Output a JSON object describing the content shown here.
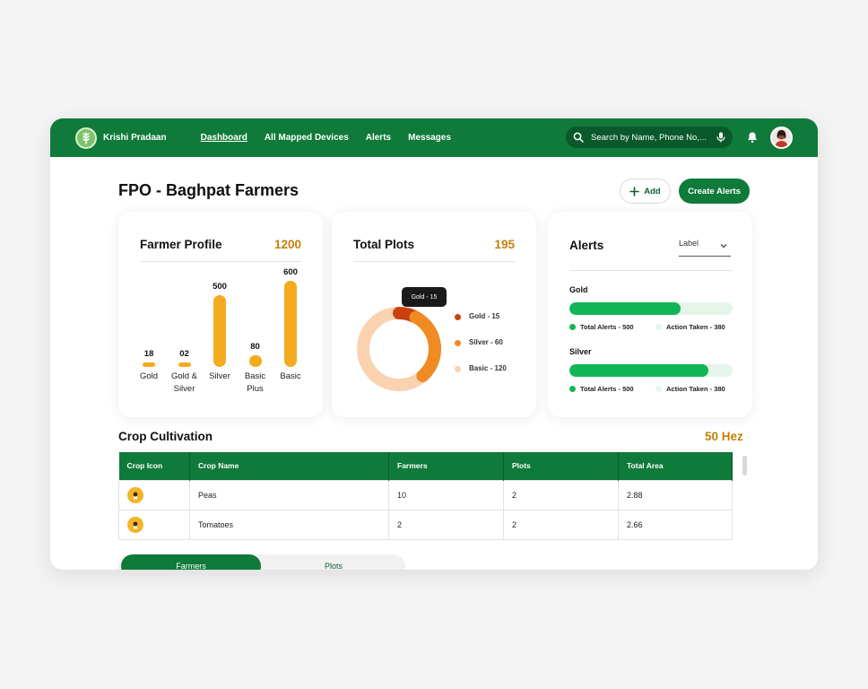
{
  "app": {
    "brand": "Krishi Pradaan"
  },
  "nav": {
    "items": [
      "Dashboard",
      "All Mapped Devices",
      "Alerts",
      "Messages"
    ]
  },
  "search": {
    "placeholder": "Search by Name, Phone No,..."
  },
  "page": {
    "title": "FPO - Baghpat Farmers",
    "add_label": "Add",
    "create_label": "Create Alerts"
  },
  "farmer_profile": {
    "title": "Farmer Profile",
    "total": "1200",
    "bars": [
      {
        "value_label": "18",
        "label": "Gold",
        "value": 18
      },
      {
        "value_label": "02",
        "label": "Gold & Silver",
        "value": 2
      },
      {
        "value_label": "500",
        "label": "Silver",
        "value": 500
      },
      {
        "value_label": "80",
        "label": "Basic Plus",
        "value": 80
      },
      {
        "value_label": "600",
        "label": "Basic",
        "value": 600
      }
    ]
  },
  "total_plots": {
    "title": "Total Plots",
    "total": "195",
    "tooltip": "Gold - 15",
    "legend": [
      {
        "label": "Gold - 15",
        "value": 15,
        "color": "#c9410f"
      },
      {
        "label": "Silver - 60",
        "value": 60,
        "color": "#f08a23"
      },
      {
        "label": "Basic - 120",
        "value": 120,
        "color": "#fbd2b0"
      }
    ]
  },
  "alerts": {
    "title": "Alerts",
    "select_label": "Label",
    "groups": [
      {
        "name": "Gold",
        "total_label": "Total Alerts - 500",
        "action_label": "Action Taken - 380",
        "fill_fraction": 0.68
      },
      {
        "name": "Silver",
        "total_label": "Total Alerts - 500",
        "action_label": "Action Taken - 380",
        "fill_fraction": 0.85
      }
    ],
    "colors": {
      "total": "#12b556",
      "action": "#e6f5ea"
    }
  },
  "crop": {
    "title": "Crop Cultivation",
    "value": "50 Hez",
    "columns": [
      "Crop Icon",
      "Crop Name",
      "Farmers",
      "Plots",
      "Total Area"
    ],
    "rows": [
      {
        "name": "Peas",
        "farmers": "10",
        "plots": "2",
        "area": "2.88"
      },
      {
        "name": "Tomatoes",
        "farmers": "2",
        "plots": "2",
        "area": "2.66"
      }
    ]
  },
  "toggle": {
    "options": [
      "Farmers",
      "Plots"
    ]
  },
  "theme": {
    "primary": "#0f7a3a",
    "accent": "#c3820a",
    "bar": "#f5ab1f"
  }
}
